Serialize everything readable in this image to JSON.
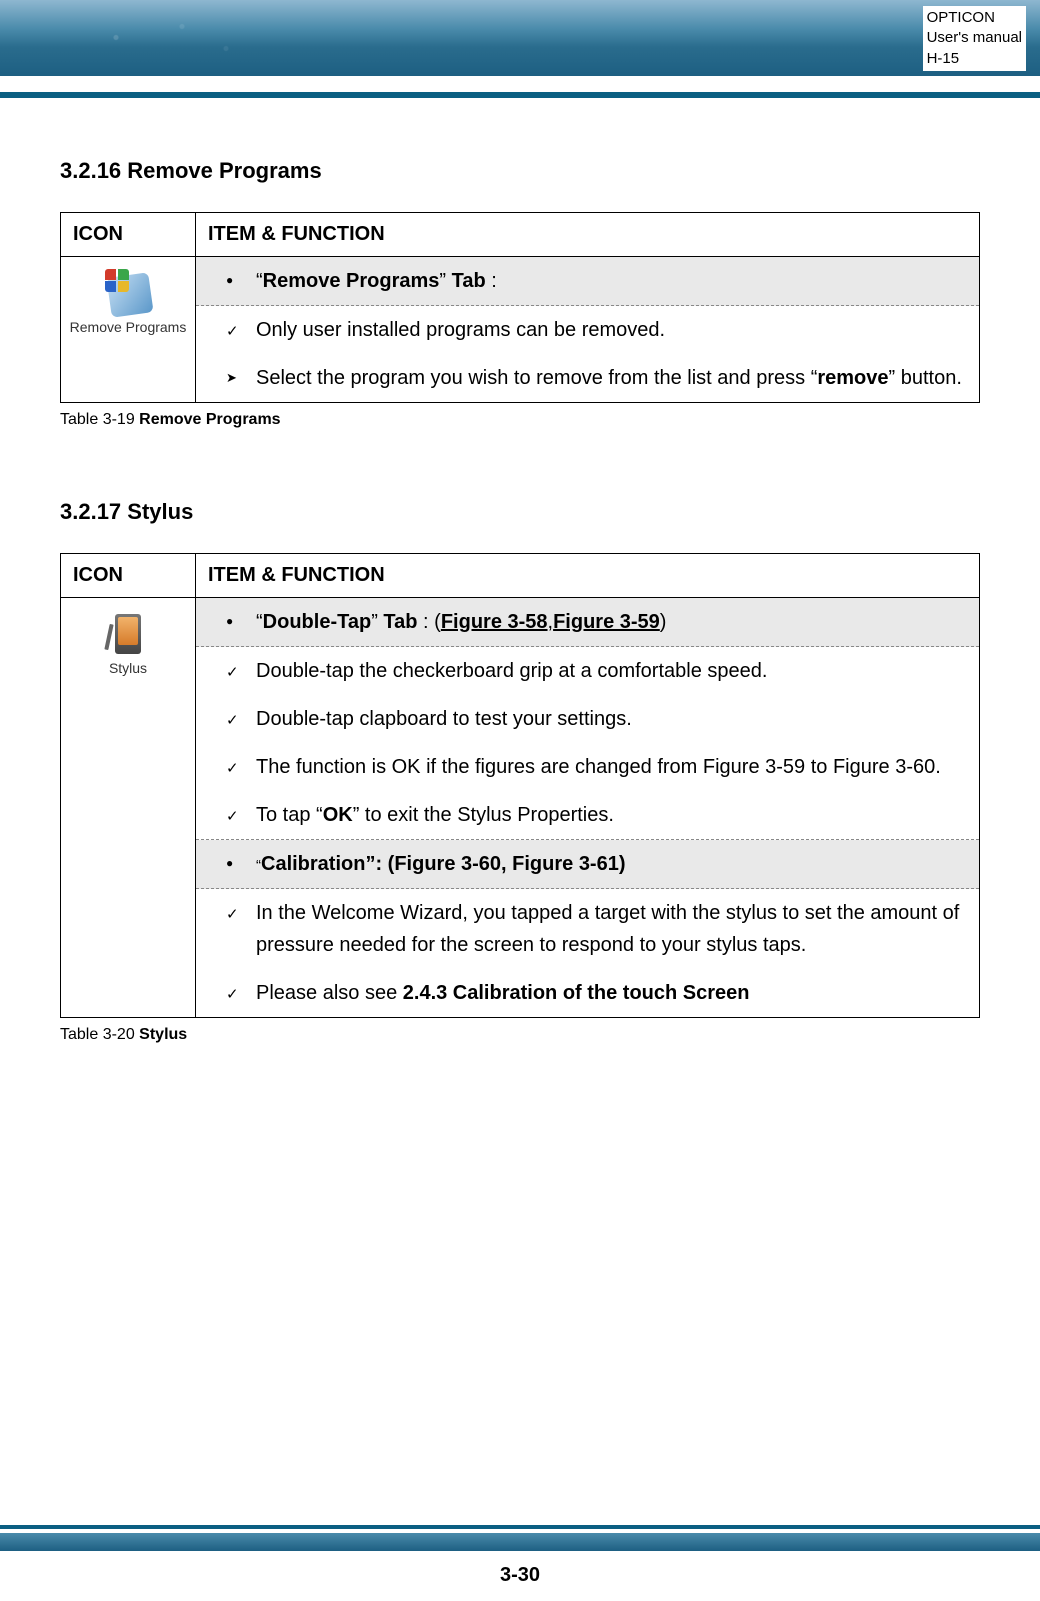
{
  "header": {
    "line1": "OPTICON",
    "line2": "User's manual",
    "line3": "H-15"
  },
  "section1": {
    "title": "3.2.16 Remove Programs",
    "col1": "ICON",
    "col2": "ITEM & FUNCTION",
    "icon_label": "Remove Programs",
    "row_tab_prefix": "“",
    "row_tab_bold": "Remove Programs",
    "row_tab_mid": "” ",
    "row_tab_bold2": "Tab",
    "row_tab_suffix": " :",
    "row1": "Only user installed programs can be removed.",
    "row2_pre": "Select the program you wish to remove from the list and press “",
    "row2_bold": "remove",
    "row2_post": "” button.",
    "caption_pre": "Table 3-19 ",
    "caption_bold": "Remove Programs"
  },
  "section2": {
    "title": "3.2.17 Stylus",
    "col1": "ICON",
    "col2": "ITEM & FUNCTION",
    "icon_label": "Stylus",
    "tab_prefix": "“",
    "tab_bold": "Double-Tap",
    "tab_mid": "” ",
    "tab_bold2": "Tab",
    "tab_sep": " : (",
    "tab_link1": "Figure 3-58",
    "tab_comma": ",",
    "tab_link2": "Figure 3-59",
    "tab_close": ")",
    "r1": "Double-tap the checkerboard grip at a comfortable speed.",
    "r2": "Double-tap clapboard to test your settings.",
    "r3": "The function is OK if the figures are changed from Figure 3-59 to Figure 3-60.",
    "r4_pre": "To tap “",
    "r4_bold": "OK",
    "r4_post": "” to exit the Stylus Properties.",
    "cal_prefix": "“",
    "cal_bold": "Calibration”: (Figure 3-60, Figure 3-61)",
    "c1": "In the Welcome Wizard, you tapped a target with the stylus to set the amount of pressure needed for the screen to respond to your stylus taps.",
    "c2_pre": "Please also see ",
    "c2_bold": "2.4.3 Calibration of the touch Screen",
    "caption_pre": "Table 3-20 ",
    "caption_bold": "Stylus"
  },
  "page_number": "3-30"
}
